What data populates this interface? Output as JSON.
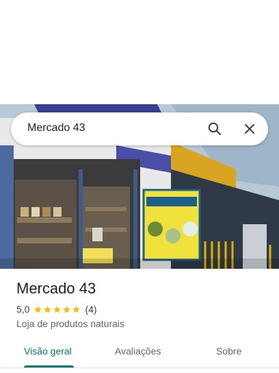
{
  "search": {
    "query": "Mercado 43",
    "search_icon": "search-icon",
    "close_icon": "close-icon"
  },
  "place": {
    "name": "Mercado 43",
    "rating": "5,0",
    "stars": 5,
    "review_count": "(4)",
    "category": "Loja de produtos naturais"
  },
  "tabs": [
    {
      "label": "Visão geral",
      "active": true
    },
    {
      "label": "Avaliações",
      "active": false
    },
    {
      "label": "Sobre",
      "active": false
    }
  ],
  "colors": {
    "accent": "#00796b",
    "star": "#fbbc04"
  }
}
